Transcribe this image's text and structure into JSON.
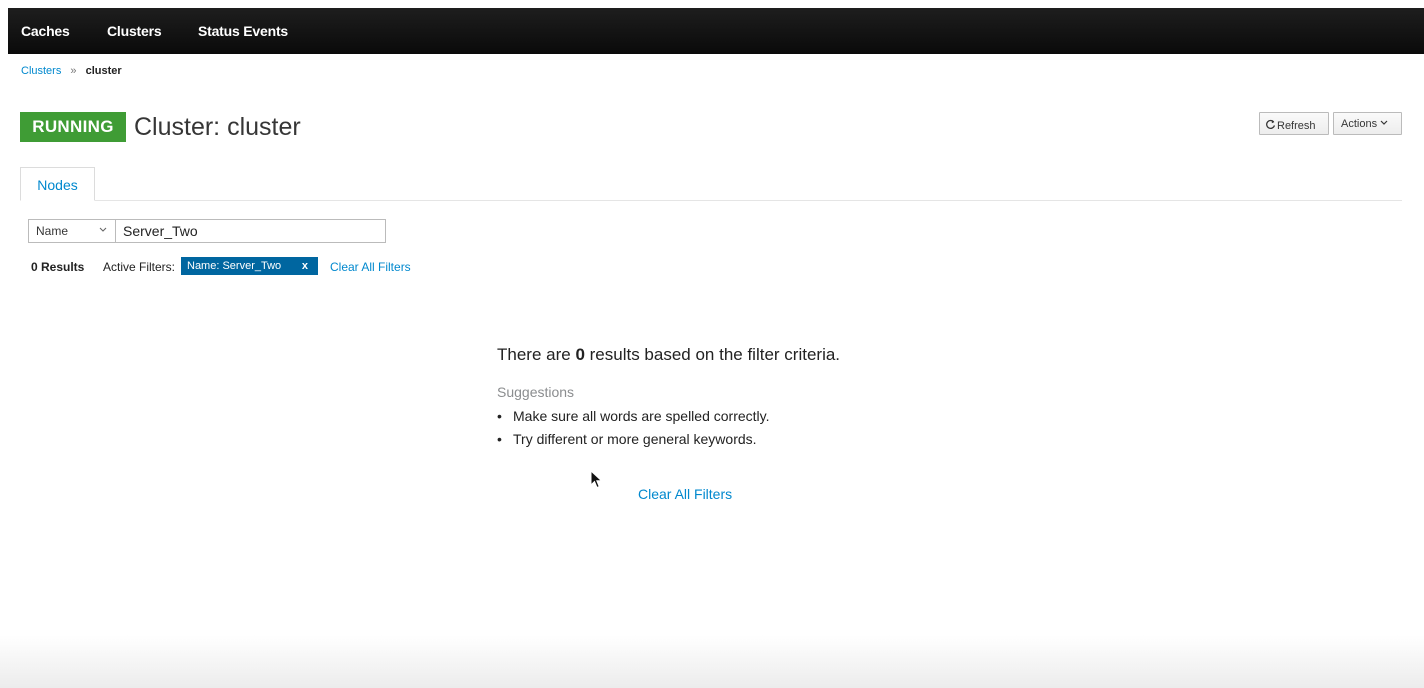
{
  "topnav": {
    "items": [
      {
        "label": "Caches"
      },
      {
        "label": "Clusters"
      },
      {
        "label": "Status Events"
      }
    ]
  },
  "breadcrumb": {
    "parent": "Clusters",
    "separator": "»",
    "current": "cluster"
  },
  "header": {
    "status": "RUNNING",
    "title": "Cluster: cluster",
    "refresh_label": "Refresh",
    "actions_label": "Actions"
  },
  "tabs": [
    {
      "label": "Nodes"
    }
  ],
  "filter": {
    "field": "Name",
    "value": "Server_Two",
    "results_count": "0 Results",
    "active_label": "Active Filters:",
    "chip_label": "Name: Server_Two",
    "chip_remove": "x",
    "clear_all": "Clear All Filters"
  },
  "empty_state": {
    "title_pre": "There are ",
    "title_count": "0",
    "title_post": " results based on the filter criteria.",
    "suggestions_label": "Suggestions",
    "suggestions": [
      "Make sure all words are spelled correctly.",
      "Try different or more general keywords."
    ],
    "clear_all": "Clear All Filters"
  },
  "colors": {
    "topbar": "#0f0f0f",
    "status_running": "#3f9c35",
    "link": "#0088ce",
    "chip": "#0066a0"
  }
}
